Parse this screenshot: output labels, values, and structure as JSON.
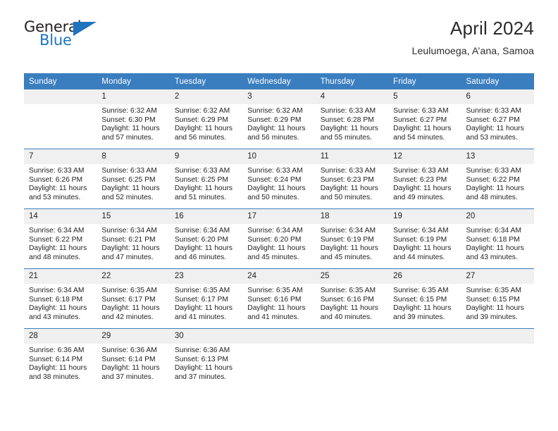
{
  "brand": {
    "name_top": "General",
    "name_bottom": "Blue",
    "accent_color": "#1e73be",
    "triangle_icon": "triangle-icon"
  },
  "header": {
    "title": "April 2024",
    "subtitle": "Leulumoega, A’ana, Samoa"
  },
  "calendar": {
    "header_bg": "#3a7ebf",
    "daynum_bg": "#f0f0f0",
    "weekday_headers": [
      "Sunday",
      "Monday",
      "Tuesday",
      "Wednesday",
      "Thursday",
      "Friday",
      "Saturday"
    ],
    "weeks": [
      [
        {
          "day": "",
          "lines": []
        },
        {
          "day": "1",
          "lines": [
            "Sunrise: 6:32 AM",
            "Sunset: 6:30 PM",
            "Daylight: 11 hours",
            "and 57 minutes."
          ]
        },
        {
          "day": "2",
          "lines": [
            "Sunrise: 6:32 AM",
            "Sunset: 6:29 PM",
            "Daylight: 11 hours",
            "and 56 minutes."
          ]
        },
        {
          "day": "3",
          "lines": [
            "Sunrise: 6:32 AM",
            "Sunset: 6:29 PM",
            "Daylight: 11 hours",
            "and 56 minutes."
          ]
        },
        {
          "day": "4",
          "lines": [
            "Sunrise: 6:33 AM",
            "Sunset: 6:28 PM",
            "Daylight: 11 hours",
            "and 55 minutes."
          ]
        },
        {
          "day": "5",
          "lines": [
            "Sunrise: 6:33 AM",
            "Sunset: 6:27 PM",
            "Daylight: 11 hours",
            "and 54 minutes."
          ]
        },
        {
          "day": "6",
          "lines": [
            "Sunrise: 6:33 AM",
            "Sunset: 6:27 PM",
            "Daylight: 11 hours",
            "and 53 minutes."
          ]
        }
      ],
      [
        {
          "day": "7",
          "lines": [
            "Sunrise: 6:33 AM",
            "Sunset: 6:26 PM",
            "Daylight: 11 hours",
            "and 53 minutes."
          ]
        },
        {
          "day": "8",
          "lines": [
            "Sunrise: 6:33 AM",
            "Sunset: 6:25 PM",
            "Daylight: 11 hours",
            "and 52 minutes."
          ]
        },
        {
          "day": "9",
          "lines": [
            "Sunrise: 6:33 AM",
            "Sunset: 6:25 PM",
            "Daylight: 11 hours",
            "and 51 minutes."
          ]
        },
        {
          "day": "10",
          "lines": [
            "Sunrise: 6:33 AM",
            "Sunset: 6:24 PM",
            "Daylight: 11 hours",
            "and 50 minutes."
          ]
        },
        {
          "day": "11",
          "lines": [
            "Sunrise: 6:33 AM",
            "Sunset: 6:23 PM",
            "Daylight: 11 hours",
            "and 50 minutes."
          ]
        },
        {
          "day": "12",
          "lines": [
            "Sunrise: 6:33 AM",
            "Sunset: 6:23 PM",
            "Daylight: 11 hours",
            "and 49 minutes."
          ]
        },
        {
          "day": "13",
          "lines": [
            "Sunrise: 6:33 AM",
            "Sunset: 6:22 PM",
            "Daylight: 11 hours",
            "and 48 minutes."
          ]
        }
      ],
      [
        {
          "day": "14",
          "lines": [
            "Sunrise: 6:34 AM",
            "Sunset: 6:22 PM",
            "Daylight: 11 hours",
            "and 48 minutes."
          ]
        },
        {
          "day": "15",
          "lines": [
            "Sunrise: 6:34 AM",
            "Sunset: 6:21 PM",
            "Daylight: 11 hours",
            "and 47 minutes."
          ]
        },
        {
          "day": "16",
          "lines": [
            "Sunrise: 6:34 AM",
            "Sunset: 6:20 PM",
            "Daylight: 11 hours",
            "and 46 minutes."
          ]
        },
        {
          "day": "17",
          "lines": [
            "Sunrise: 6:34 AM",
            "Sunset: 6:20 PM",
            "Daylight: 11 hours",
            "and 45 minutes."
          ]
        },
        {
          "day": "18",
          "lines": [
            "Sunrise: 6:34 AM",
            "Sunset: 6:19 PM",
            "Daylight: 11 hours",
            "and 45 minutes."
          ]
        },
        {
          "day": "19",
          "lines": [
            "Sunrise: 6:34 AM",
            "Sunset: 6:19 PM",
            "Daylight: 11 hours",
            "and 44 minutes."
          ]
        },
        {
          "day": "20",
          "lines": [
            "Sunrise: 6:34 AM",
            "Sunset: 6:18 PM",
            "Daylight: 11 hours",
            "and 43 minutes."
          ]
        }
      ],
      [
        {
          "day": "21",
          "lines": [
            "Sunrise: 6:34 AM",
            "Sunset: 6:18 PM",
            "Daylight: 11 hours",
            "and 43 minutes."
          ]
        },
        {
          "day": "22",
          "lines": [
            "Sunrise: 6:35 AM",
            "Sunset: 6:17 PM",
            "Daylight: 11 hours",
            "and 42 minutes."
          ]
        },
        {
          "day": "23",
          "lines": [
            "Sunrise: 6:35 AM",
            "Sunset: 6:17 PM",
            "Daylight: 11 hours",
            "and 41 minutes."
          ]
        },
        {
          "day": "24",
          "lines": [
            "Sunrise: 6:35 AM",
            "Sunset: 6:16 PM",
            "Daylight: 11 hours",
            "and 41 minutes."
          ]
        },
        {
          "day": "25",
          "lines": [
            "Sunrise: 6:35 AM",
            "Sunset: 6:16 PM",
            "Daylight: 11 hours",
            "and 40 minutes."
          ]
        },
        {
          "day": "26",
          "lines": [
            "Sunrise: 6:35 AM",
            "Sunset: 6:15 PM",
            "Daylight: 11 hours",
            "and 39 minutes."
          ]
        },
        {
          "day": "27",
          "lines": [
            "Sunrise: 6:35 AM",
            "Sunset: 6:15 PM",
            "Daylight: 11 hours",
            "and 39 minutes."
          ]
        }
      ],
      [
        {
          "day": "28",
          "lines": [
            "Sunrise: 6:36 AM",
            "Sunset: 6:14 PM",
            "Daylight: 11 hours",
            "and 38 minutes."
          ]
        },
        {
          "day": "29",
          "lines": [
            "Sunrise: 6:36 AM",
            "Sunset: 6:14 PM",
            "Daylight: 11 hours",
            "and 37 minutes."
          ]
        },
        {
          "day": "30",
          "lines": [
            "Sunrise: 6:36 AM",
            "Sunset: 6:13 PM",
            "Daylight: 11 hours",
            "and 37 minutes."
          ]
        },
        {
          "day": "",
          "lines": []
        },
        {
          "day": "",
          "lines": []
        },
        {
          "day": "",
          "lines": []
        },
        {
          "day": "",
          "lines": []
        }
      ]
    ]
  }
}
